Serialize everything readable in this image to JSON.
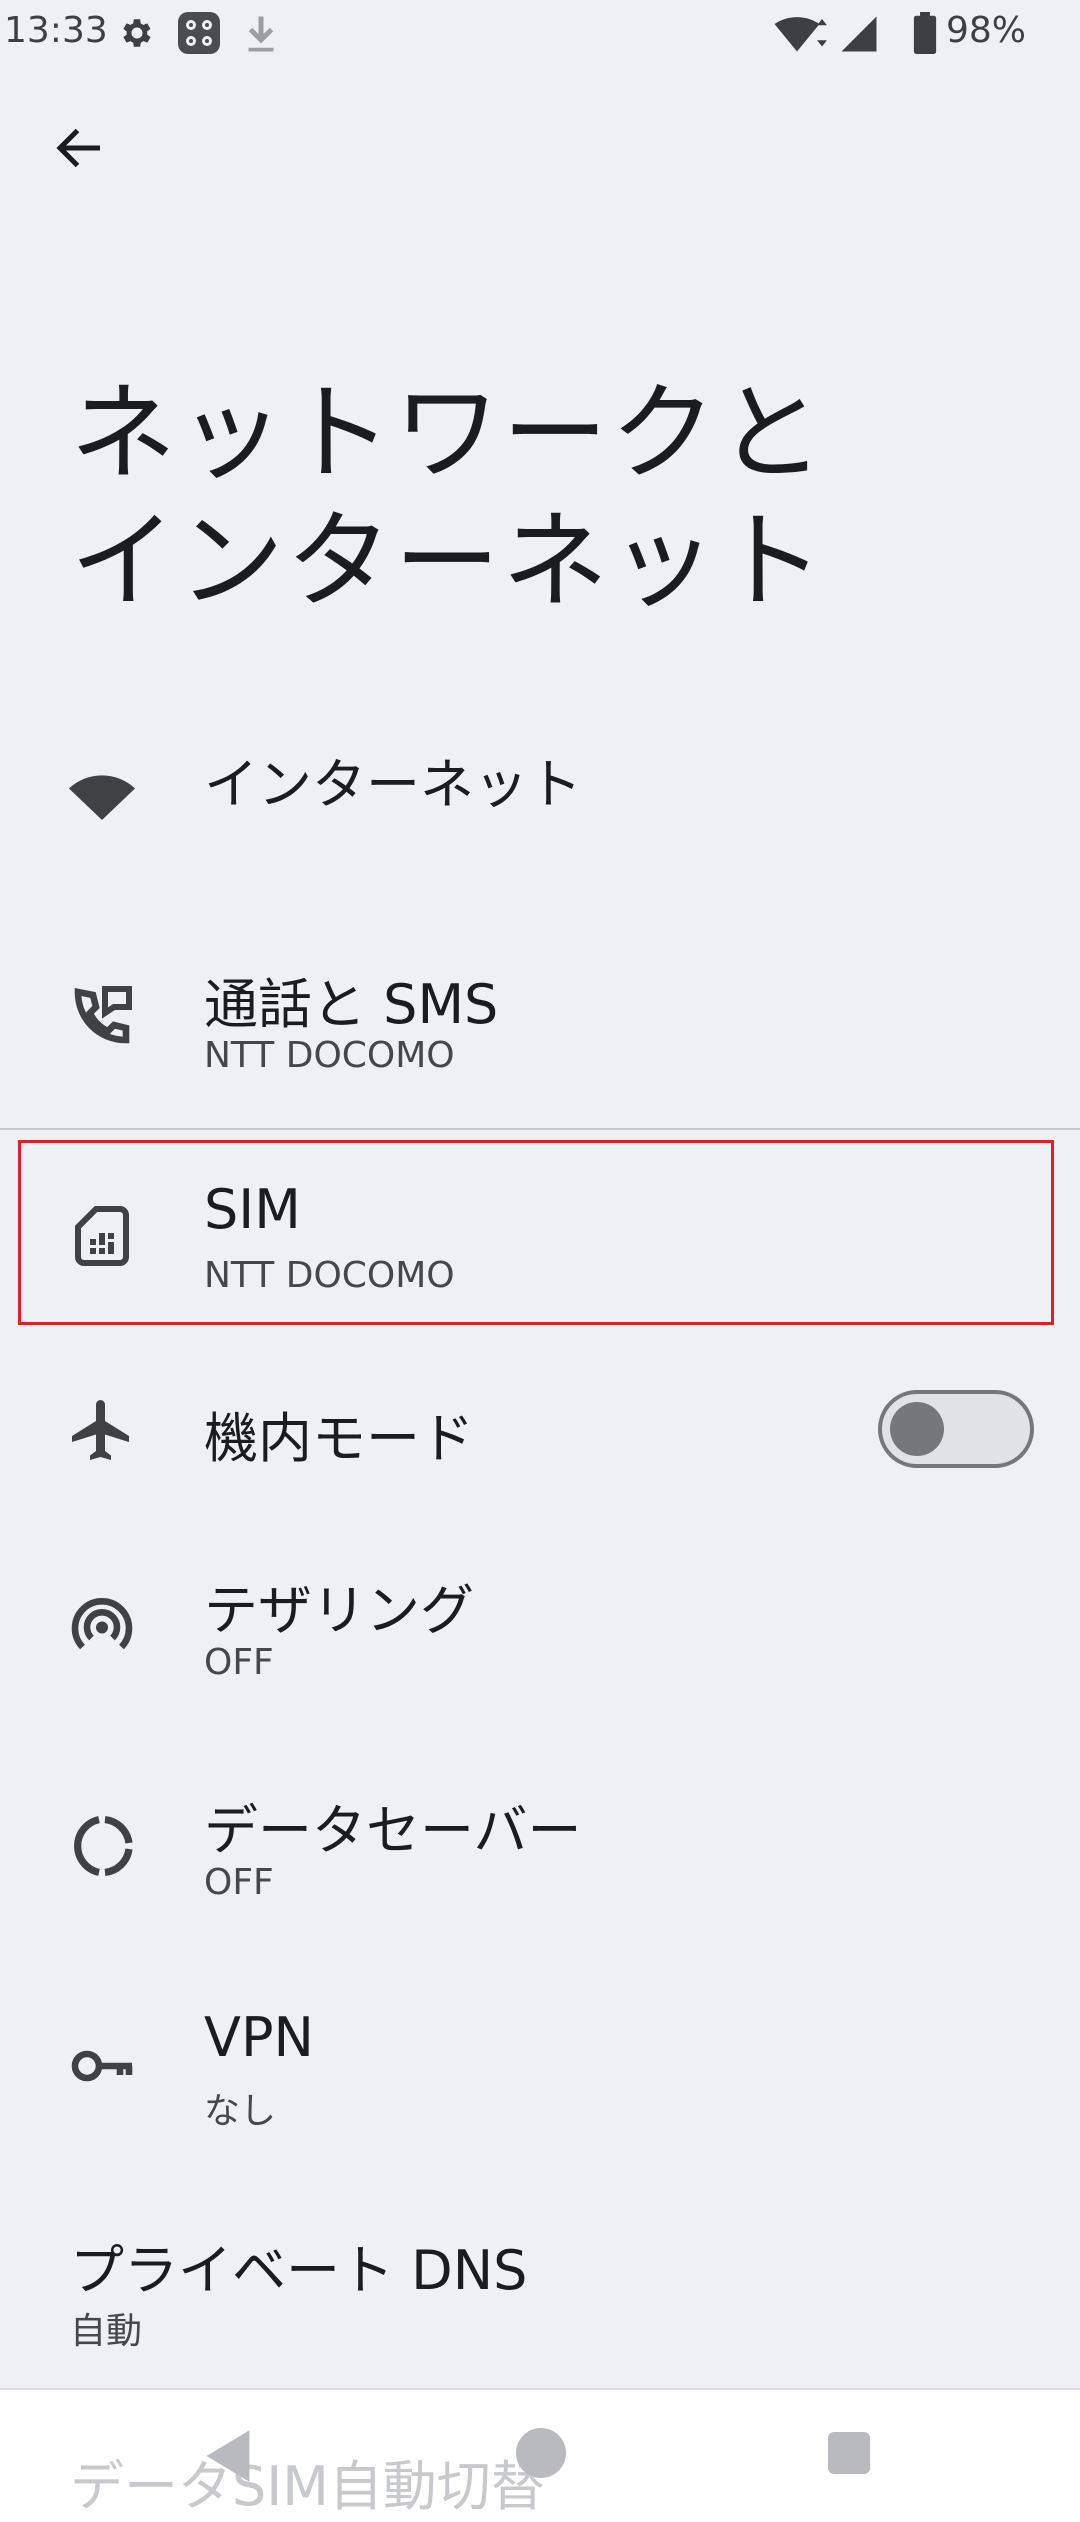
{
  "status_bar": {
    "time": "13:33",
    "battery_percent": "98%",
    "icons": [
      "gear-icon",
      "app-notification-icon",
      "download-icon",
      "wifi-icon",
      "signal-icon",
      "battery-icon"
    ]
  },
  "header": {
    "back_icon": "arrow-left-icon",
    "title_line1": "ネットワークと",
    "title_line2": "インターネット"
  },
  "items": [
    {
      "icon": "wifi-icon",
      "label": "インターネット",
      "sub": ""
    },
    {
      "icon": "phone-sms-icon",
      "label": "通話と SMS",
      "sub": "NTT DOCOMO"
    },
    {
      "icon": "sim-card-icon",
      "label": "SIM",
      "sub": "NTT DOCOMO",
      "highlighted": true
    },
    {
      "icon": "airplane-icon",
      "label": "機内モード",
      "sub": "",
      "toggle": "off"
    },
    {
      "icon": "hotspot-icon",
      "label": "テザリング",
      "sub": "OFF"
    },
    {
      "icon": "data-saver-icon",
      "label": "データセーバー",
      "sub": "OFF"
    },
    {
      "icon": "vpn-key-icon",
      "label": "VPN",
      "sub": "なし"
    },
    {
      "icon": "",
      "label": "プライベート DNS",
      "sub": "自動"
    }
  ],
  "partial_item": {
    "label": "データSIM自動切替"
  },
  "colors": {
    "background": "#eef0f6",
    "highlight_border": "#d9222b",
    "text": "#1b1c20"
  }
}
